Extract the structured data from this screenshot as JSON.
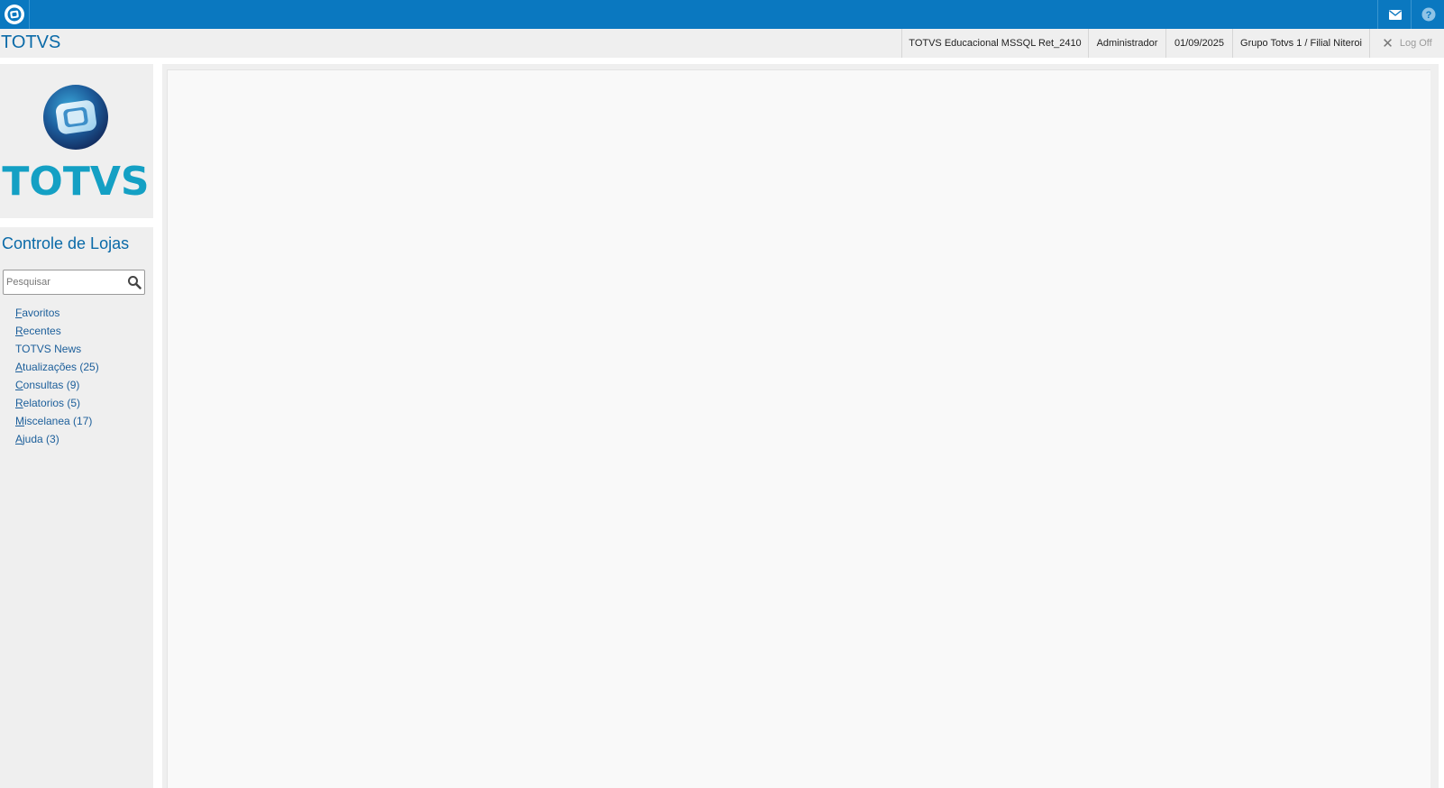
{
  "topbar": {
    "logo_icon": "totvs-logo-icon",
    "mail_icon": "mail-icon",
    "help_icon": "help-icon",
    "bar_color": "#0a78c0"
  },
  "header": {
    "app_title": "TOTVS",
    "environment": "TOTVS Educacional MSSQL Ret_2410",
    "user": "Administrador",
    "date": "01/09/2025",
    "company": "Grupo Totvs 1 / Filial Niteroi",
    "logoff_label": "Log Off"
  },
  "sidebar": {
    "brand_text": "TOTVS",
    "module_title": "Controle de Lojas",
    "search_placeholder": "Pesquisar",
    "items": [
      {
        "first": "F",
        "rest": "avoritos"
      },
      {
        "first": "R",
        "rest": "ecentes"
      },
      {
        "first": "",
        "rest": "TOTVS News"
      },
      {
        "first": "A",
        "rest": "tualizações (25)"
      },
      {
        "first": "C",
        "rest": "onsultas (9)"
      },
      {
        "first": "R",
        "rest": "elatorios (5)"
      },
      {
        "first": "M",
        "rest": "iscelanea (17)"
      },
      {
        "first": "A",
        "rest": "juda (3)"
      }
    ]
  }
}
